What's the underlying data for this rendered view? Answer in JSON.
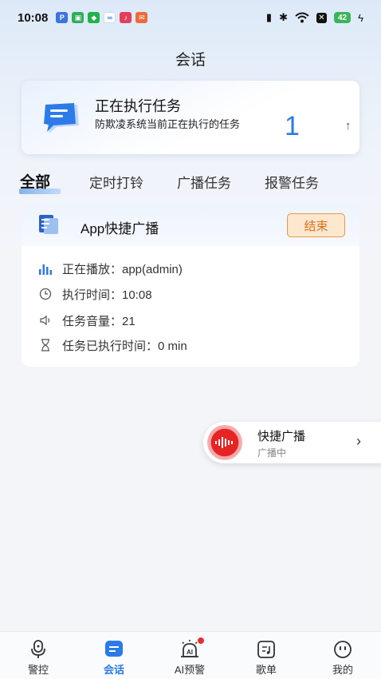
{
  "status_bar": {
    "time": "10:08",
    "battery": "42",
    "notification_icons": [
      "pi-icon",
      "shopping-icon",
      "shield-icon",
      "cloud-icon",
      "music-icon",
      "mail-icon"
    ]
  },
  "page": {
    "title": "会话"
  },
  "task_card": {
    "title": "正在执行任务",
    "description": "防欺凌系统当前正在执行的任务",
    "count": "1",
    "arrow": "↑"
  },
  "tabs": [
    {
      "label": "全部",
      "active": true
    },
    {
      "label": "定时打铃",
      "active": false
    },
    {
      "label": "广播任务",
      "active": false
    },
    {
      "label": "报警任务",
      "active": false
    }
  ],
  "broadcast": {
    "title": "App快捷广播",
    "end_label": "结束",
    "rows": [
      {
        "icon": "bars-icon",
        "text": "正在播放：app(admin)"
      },
      {
        "icon": "clock-icon",
        "text": "执行时间：10:08"
      },
      {
        "icon": "volume-icon",
        "text": "任务音量：21"
      },
      {
        "icon": "hourglass-icon",
        "text": "任务已执行时间：0 min"
      }
    ]
  },
  "floating": {
    "title": "快捷广播",
    "subtitle": "广播中",
    "arrow": "›"
  },
  "nav": [
    {
      "label": "警控",
      "icon": "microphone-icon",
      "active": false
    },
    {
      "label": "会话",
      "icon": "chat-icon",
      "active": true
    },
    {
      "label": "AI预警",
      "icon": "ai-alarm-icon",
      "active": false,
      "badge": true
    },
    {
      "label": "歌单",
      "icon": "music-list-icon",
      "active": false
    },
    {
      "label": "我的",
      "icon": "profile-face-icon",
      "active": false
    }
  ],
  "colors": {
    "accent": "#2a7be6",
    "end_button_bg": "#fde7cf",
    "end_button_text": "#d7731e",
    "recording_red": "#e62424"
  }
}
